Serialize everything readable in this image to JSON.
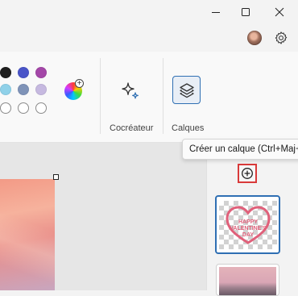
{
  "ribbon": {
    "palette": {
      "row1": [
        "#1f1f1f",
        "#4a55c8",
        "#a447a8"
      ],
      "row2": [
        "#8fd1e9",
        "#7f93b8",
        "#c6b9e0"
      ],
      "row3": [
        "#ffffff",
        "#ffffff",
        "#ffffff"
      ]
    },
    "cocreator_label": "Cocréateur",
    "layers_label": "Calques"
  },
  "tooltip": {
    "text": "Créer un calque (Ctrl+Maj+N)"
  },
  "layers_panel": {
    "thumbnail_text": "HAPPY VALENTINE'S DAY"
  },
  "colors": {
    "accent": "#2f6fb3",
    "highlight": "#d93a3a",
    "thumb_text": "#e0607a"
  }
}
